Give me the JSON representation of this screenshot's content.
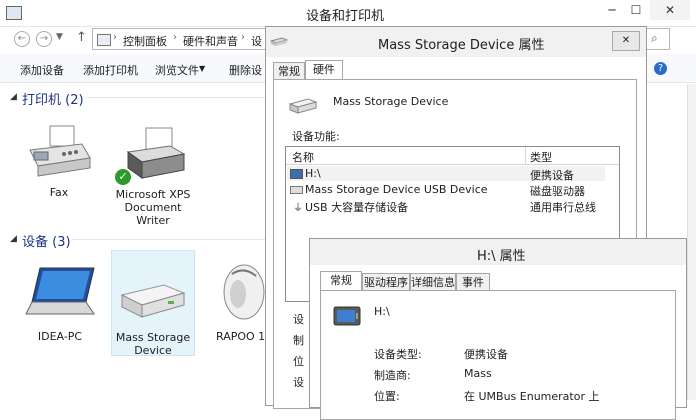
{
  "main_window": {
    "title": "设备和打印机",
    "breadcrumb": [
      "控制面板",
      "硬件和声音",
      "设"
    ],
    "toolbar": {
      "add_device": "添加设备",
      "add_printer": "添加打印机",
      "browse_files": "浏览文件",
      "remove_device": "删除设"
    },
    "groups": {
      "printers": {
        "title": "打印机 (2)",
        "items": [
          "Fax",
          "Microsoft XPS\nDocument\nWriter"
        ]
      },
      "devices": {
        "title": "设备 (3)",
        "items": [
          "IDEA-PC",
          "Mass Storage\nDevice",
          "RAPOO 1"
        ]
      }
    },
    "bottom_labels": [
      "设",
      "制",
      "位",
      "设"
    ]
  },
  "mass_dialog": {
    "title": "Mass Storage Device 属性",
    "tabs": [
      "常规",
      "硬件"
    ],
    "device_name": "Mass Storage Device",
    "functions_label": "设备功能:",
    "columns": [
      "名称",
      "类型"
    ],
    "rows": [
      {
        "name": "H:\\",
        "type": "便携设备"
      },
      {
        "name": "Mass Storage Device USB Device",
        "type": "磁盘驱动器"
      },
      {
        "name": "USB 大容量存储设备",
        "type": "通用串行总线"
      }
    ]
  },
  "h_dialog": {
    "title": "H:\\ 属性",
    "tabs": [
      "常规",
      "驱动程序",
      "详细信息",
      "事件"
    ],
    "device_name": "H:\\",
    "props": [
      {
        "label": "设备类型:",
        "value": "便携设备"
      },
      {
        "label": "制造商:",
        "value": "Mass"
      },
      {
        "label": "位置:",
        "value": "在 UMBus Enumerator 上"
      }
    ]
  },
  "colors": {
    "group_title": "#1e3287",
    "selection": "#cce8ff",
    "window_border": "#9a9a9a"
  }
}
